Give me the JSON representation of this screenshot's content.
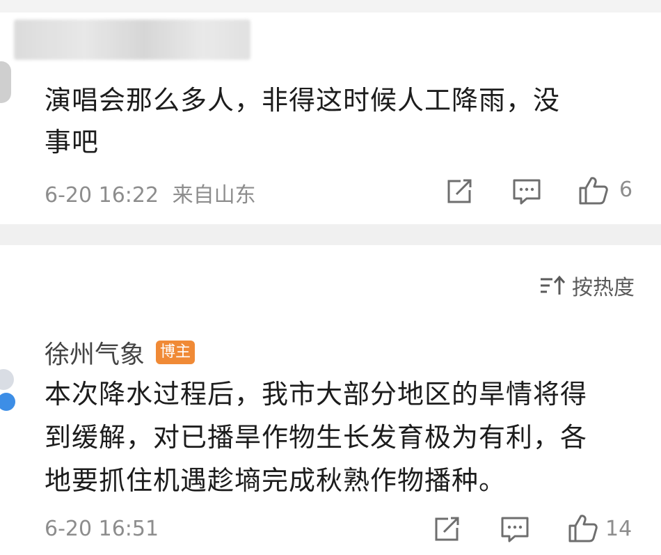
{
  "comments": [
    {
      "text_line1": "演唱会那么多人，非得这时候人工降雨，没",
      "text_line2": "事吧",
      "time": "6-20 16:22",
      "location": "来自山东",
      "likes": "6"
    },
    {
      "author": "徐州气象",
      "badge": "博主",
      "text_line1": "本次降水过程后，我市大部分地区的旱情将得",
      "text_line2": "到缓解，对已播旱作物生长发育极为有利，各",
      "text_line3": "地要抓住机遇趁墒完成秋熟作物播种。",
      "time": "6-20 16:51",
      "likes": "14"
    }
  ],
  "sort": {
    "label": "按热度"
  },
  "icons": {
    "share": "share-icon",
    "comment": "comment-icon",
    "like": "thumbs-up-icon",
    "sort": "sort-icon",
    "verified": "verified-badge-icon"
  },
  "colors": {
    "badge": "#f08a36",
    "verified": "#3d8ee6",
    "meta": "#8d8d8d"
  }
}
